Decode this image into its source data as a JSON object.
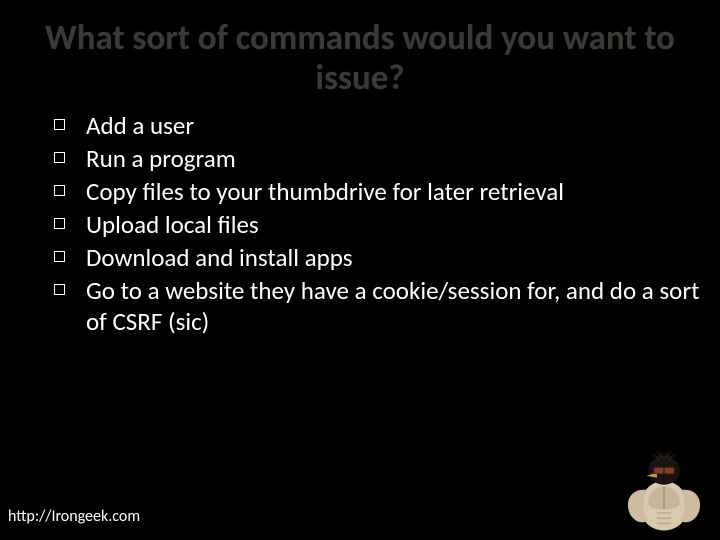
{
  "title": "What sort of commands would you want to issue?",
  "bullets": [
    "Add a user",
    "Run a program",
    "Copy files to your thumbdrive for later retrieval",
    "Upload local files",
    "Download and install apps",
    "Go to a website they have a cookie/session for, and do a sort of CSRF (sic)"
  ],
  "footer": "http://Irongeek.com"
}
